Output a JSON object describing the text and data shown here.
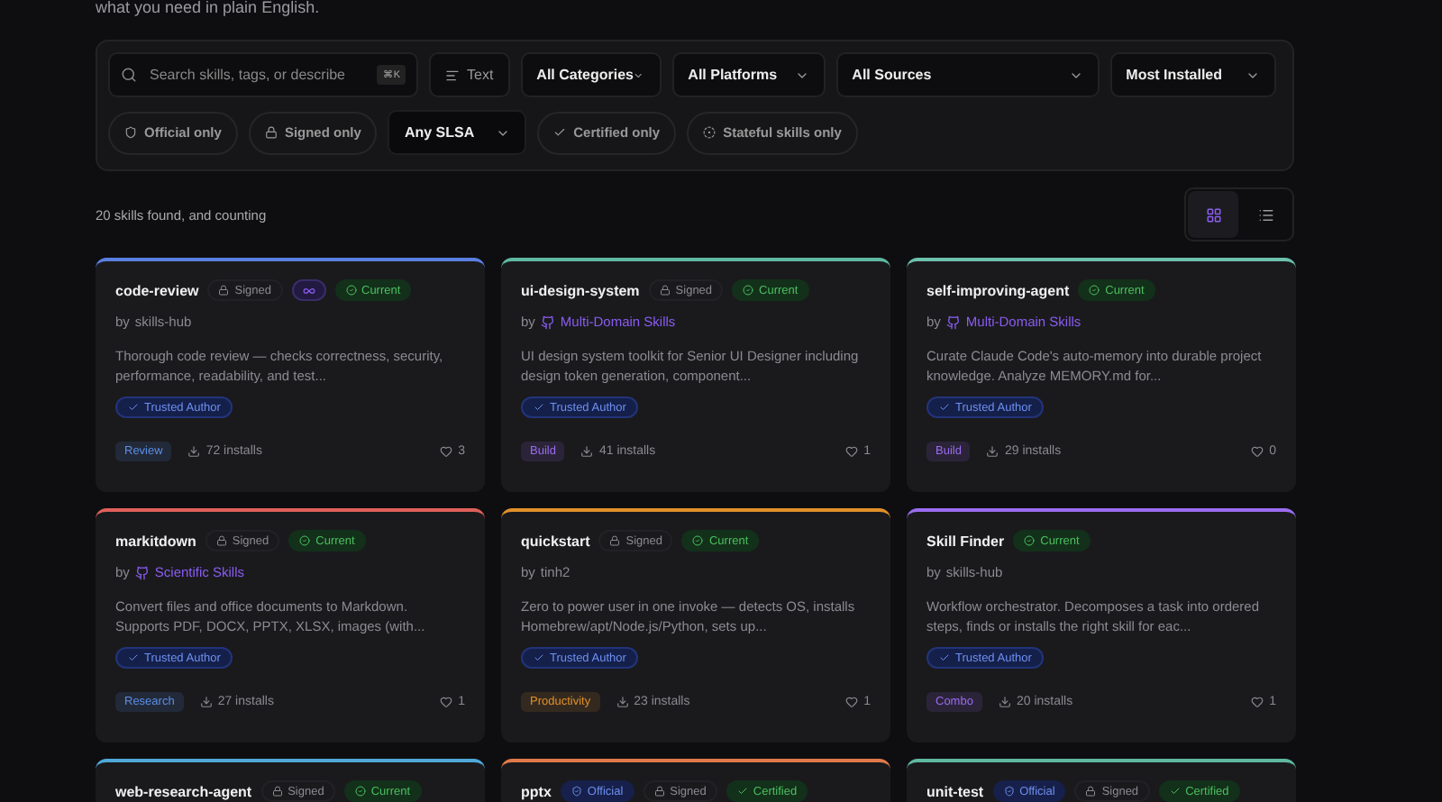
{
  "intro": "what you need in plain English.",
  "filters": {
    "search": {
      "placeholder": "Search skills, tags, or describe",
      "shortcut": "⌘K"
    },
    "mode": {
      "label": "Text"
    },
    "selects": [
      {
        "label": "All Categories"
      },
      {
        "label": "All Platforms"
      },
      {
        "label": "All Sources"
      },
      {
        "label": "Most Installed"
      }
    ],
    "chips": [
      {
        "kind": "toggle",
        "label": "Official only",
        "selected": false
      },
      {
        "kind": "toggle",
        "label": "Signed only",
        "selected": false
      },
      {
        "kind": "select",
        "label": "Any SLSA"
      },
      {
        "kind": "toggle",
        "label": "Certified only",
        "selected": false
      },
      {
        "kind": "toggle",
        "label": "Stateful skills only",
        "selected": false
      }
    ]
  },
  "results": {
    "count": "20 skills found, and counting",
    "views": [
      {
        "selected": true
      },
      {
        "selected": false
      }
    ]
  },
  "cards": [
    {
      "title": "code-review",
      "color": "#5b7fe0",
      "badges": [
        {
          "kind": "signed",
          "label": "Signed"
        },
        {
          "kind": "loop"
        },
        {
          "kind": "current",
          "label": "Current"
        }
      ],
      "author": {
        "prefix": "by",
        "name": "skills-hub",
        "github": false
      },
      "description": "Thorough code review — checks correctness, security, performance, readability, and test...",
      "trust": "Trusted Author",
      "tag": {
        "label": "Review",
        "color": "#5b8fe8"
      },
      "installs": "72 installs",
      "likes": "3"
    },
    {
      "title": "ui-design-system",
      "color": "#5fb8a0",
      "badges": [
        {
          "kind": "signed",
          "label": "Signed"
        },
        {
          "kind": "current",
          "label": "Current"
        }
      ],
      "author": {
        "prefix": "by",
        "name": "Multi-Domain Skills",
        "github": true
      },
      "description": "UI design system toolkit for Senior UI Designer including design token generation, component...",
      "trust": "Trusted Author",
      "tag": {
        "label": "Build",
        "color": "#9b6cf0"
      },
      "installs": "41 installs",
      "likes": "1"
    },
    {
      "title": "self-improving-agent",
      "color": "#6cc0ac",
      "badges": [
        {
          "kind": "current",
          "label": "Current"
        }
      ],
      "author": {
        "prefix": "by",
        "name": "Multi-Domain Skills",
        "github": true
      },
      "description": "Curate Claude Code's auto-memory into durable project knowledge. Analyze MEMORY.md for...",
      "trust": "Trusted Author",
      "tag": {
        "label": "Build",
        "color": "#9b6cf0"
      },
      "installs": "29 installs",
      "likes": "0"
    },
    {
      "title": "markitdown",
      "color": "#e0605a",
      "badges": [
        {
          "kind": "signed",
          "label": "Signed"
        },
        {
          "kind": "current",
          "label": "Current"
        }
      ],
      "author": {
        "prefix": "by",
        "name": "Scientific Skills",
        "github": true
      },
      "description": "Convert files and office documents to Markdown. Supports PDF, DOCX, PPTX, XLSX, images (with...",
      "trust": "Trusted Author",
      "tag": {
        "label": "Research",
        "color": "#5b8fe8"
      },
      "installs": "27 installs",
      "likes": "1"
    },
    {
      "title": "quickstart",
      "color": "#e0902a",
      "badges": [
        {
          "kind": "signed",
          "label": "Signed"
        },
        {
          "kind": "current",
          "label": "Current"
        }
      ],
      "author": {
        "prefix": "by",
        "name": "tinh2",
        "github": false
      },
      "description": "Zero to power user in one invoke — detects OS, installs Homebrew/apt/Node.js/Python, sets up...",
      "trust": "Trusted Author",
      "tag": {
        "label": "Productivity",
        "color": "#e0902a"
      },
      "installs": "23 installs",
      "likes": "1"
    },
    {
      "title": "Skill Finder",
      "color": "#9b6cf0",
      "badges": [
        {
          "kind": "current",
          "label": "Current"
        }
      ],
      "author": {
        "prefix": "by",
        "name": "skills-hub",
        "github": false
      },
      "description": "Workflow orchestrator. Decomposes a task into ordered steps, finds or installs the right skill for eac...",
      "trust": "Trusted Author",
      "tag": {
        "label": "Combo",
        "color": "#9b6cf0"
      },
      "installs": "20 installs",
      "likes": "1"
    },
    {
      "title": "web-research-agent",
      "color": "#4fa8d8",
      "badges": [
        {
          "kind": "signed",
          "label": "Signed"
        },
        {
          "kind": "current",
          "label": "Current"
        }
      ]
    },
    {
      "title": "pptx",
      "color": "#e07a4a",
      "badges": [
        {
          "kind": "official",
          "label": "Official"
        },
        {
          "kind": "signed",
          "label": "Signed"
        },
        {
          "kind": "certified",
          "label": "Certified"
        }
      ]
    },
    {
      "title": "unit-test",
      "color": "#5fb8a0",
      "badges": [
        {
          "kind": "official",
          "label": "Official"
        },
        {
          "kind": "signed",
          "label": "Signed"
        },
        {
          "kind": "certified",
          "label": "Certified"
        }
      ]
    }
  ]
}
